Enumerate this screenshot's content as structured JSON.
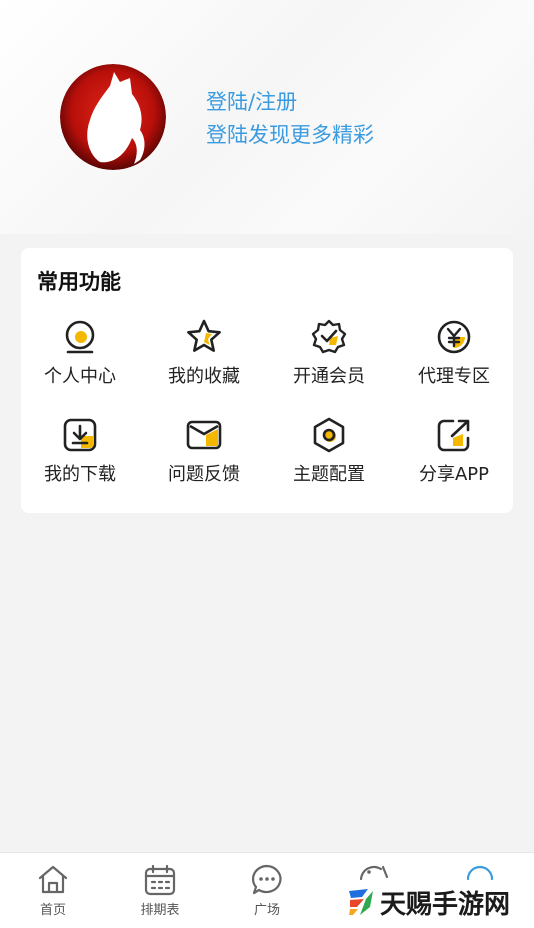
{
  "profile": {
    "login_label": "登陆/注册",
    "login_subtitle": "登陆发现更多精彩"
  },
  "functions": {
    "title": "常用功能",
    "items": [
      {
        "label": "个人中心",
        "icon": "user-center-icon"
      },
      {
        "label": "我的收藏",
        "icon": "star-icon"
      },
      {
        "label": "开通会员",
        "icon": "vip-badge-icon"
      },
      {
        "label": "代理专区",
        "icon": "yen-coin-icon"
      },
      {
        "label": "我的下载",
        "icon": "download-icon"
      },
      {
        "label": "问题反馈",
        "icon": "feedback-mail-icon"
      },
      {
        "label": "主题配置",
        "icon": "theme-hexagon-icon"
      },
      {
        "label": "分享APP",
        "icon": "share-icon"
      }
    ]
  },
  "tabbar": {
    "items": [
      {
        "label": "首页",
        "icon": "home-icon"
      },
      {
        "label": "排期表",
        "icon": "calendar-icon"
      },
      {
        "label": "广场",
        "icon": "chat-bubble-icon"
      },
      {
        "label": "",
        "icon": "discover-icon"
      },
      {
        "label": "",
        "icon": "profile-tab-icon"
      }
    ]
  },
  "watermark": {
    "text": "天赐手游网"
  },
  "colors": {
    "accent_blue": "#3a9be0",
    "icon_yellow": "#f5b800",
    "icon_dark": "#222222",
    "avatar_red": "#c8140e"
  }
}
